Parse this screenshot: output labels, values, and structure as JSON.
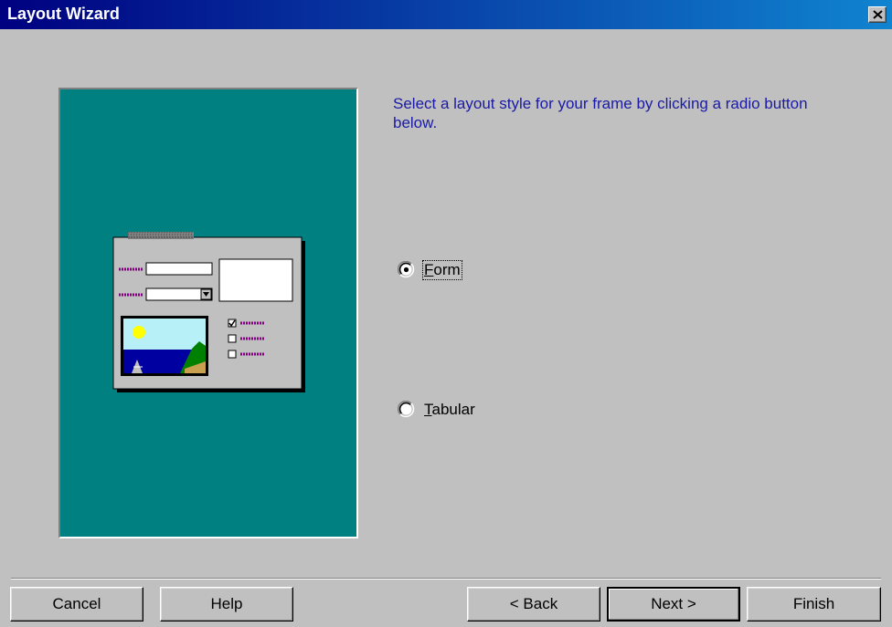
{
  "window": {
    "title": "Layout Wizard",
    "close_icon": "close-icon"
  },
  "instructions": "Select a layout style for your frame by clicking a radio button below.",
  "options": [
    {
      "label": "Form",
      "selected": true,
      "accelerator": "F"
    },
    {
      "label": "Tabular",
      "selected": false,
      "accelerator": "T"
    }
  ],
  "buttons": {
    "cancel": "Cancel",
    "help": "Help",
    "back": "< Back",
    "next": "Next >",
    "finish": "Finish"
  },
  "colors": {
    "title_bar": "#000080",
    "preview_background": "#008080",
    "dialog_background": "#c0c0c0",
    "instruction_text": "#1a1aa6"
  }
}
